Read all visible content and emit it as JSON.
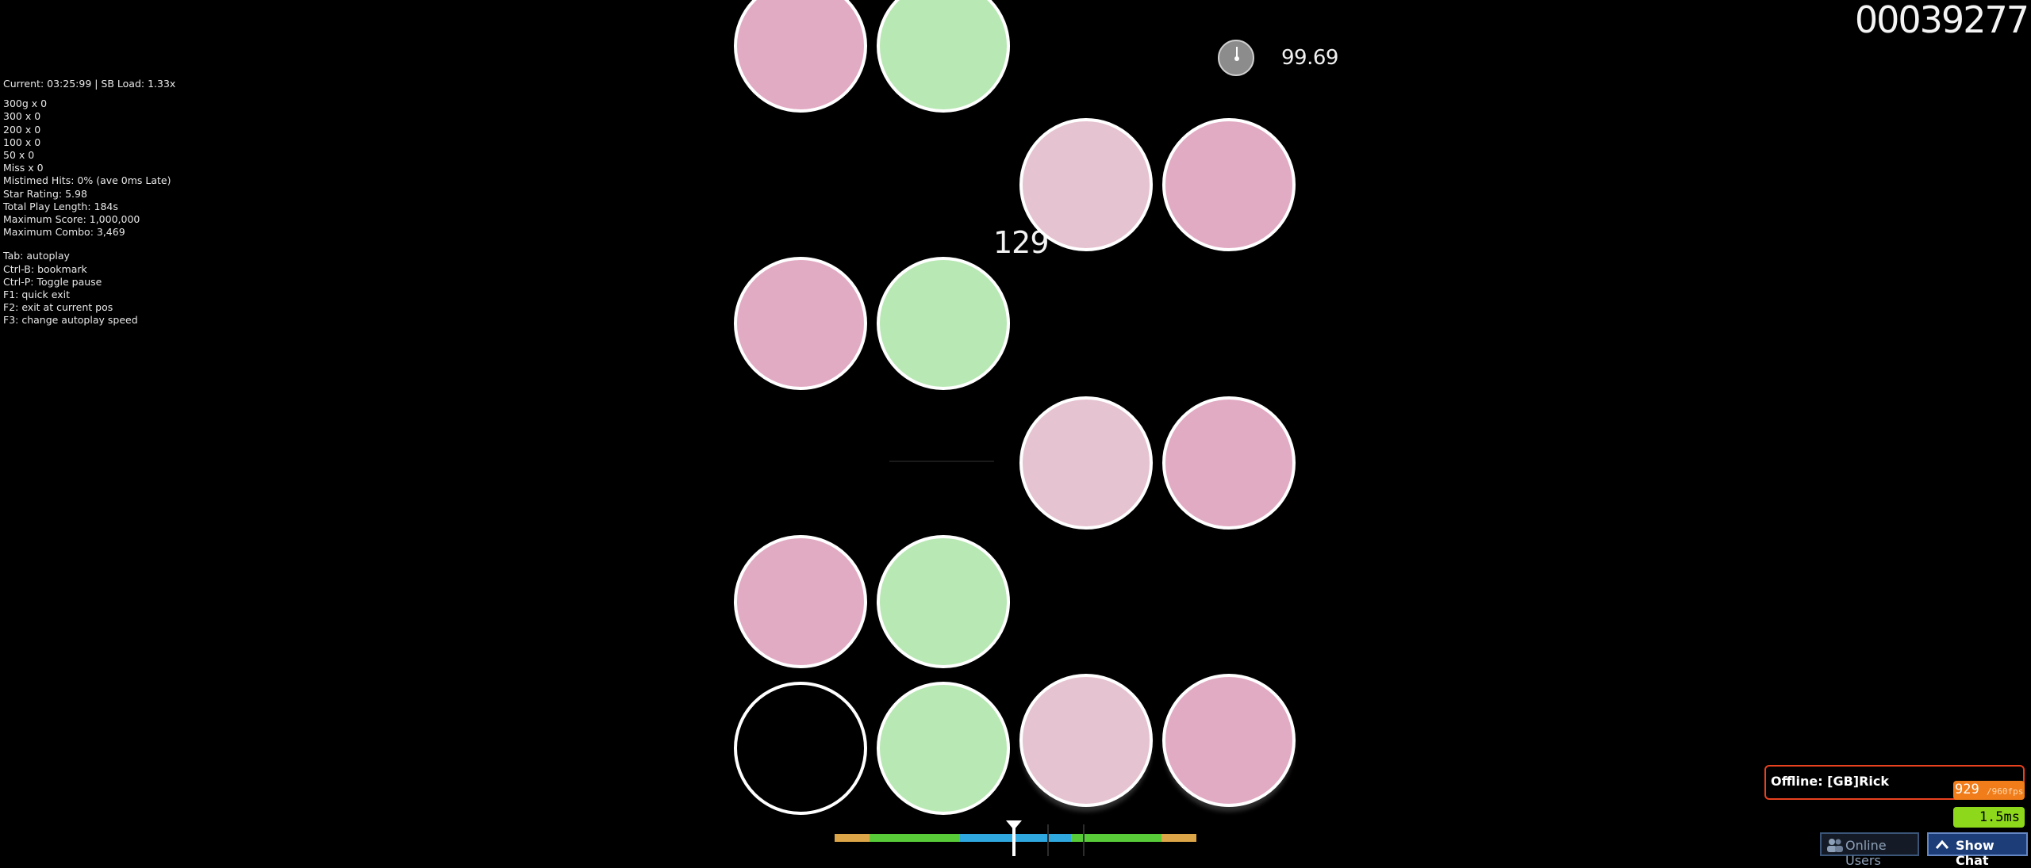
{
  "debug": {
    "current_line": "Current: 03:25:99 | SB Load: 1.33x",
    "judgements": [
      "300g x 0",
      "300 x 0",
      "200 x 0",
      "100 x 0",
      "50 x 0",
      "Miss x 0"
    ],
    "stats": [
      "Mistimed Hits: 0% (ave 0ms Late)",
      "Star Rating: 5.98",
      "Total Play Length: 184s",
      "Maximum Score: 1,000,000",
      "Maximum Combo: 3,469"
    ],
    "shortcuts": [
      "Tab: autoplay",
      "Ctrl-B: bookmark",
      "Ctrl-P: Toggle pause",
      "F1: quick exit",
      "F2: exit at current pos",
      "F3: change autoplay speed"
    ]
  },
  "hud": {
    "score": "00039277",
    "accuracy": "99.69",
    "combo": "129"
  },
  "status": {
    "user": "Offline: [GB]Rick",
    "fps": "929",
    "fps_max": "/960fps",
    "latency": "1.5ms"
  },
  "buttons": {
    "online_users": "Online Users",
    "show_chat": "Show Chat"
  },
  "colors": {
    "note_pink": "#e2abc4",
    "note_light_pink": "#e6c3d0",
    "note_green": "#b8e8b4",
    "user_panel_border": "#e8421f",
    "fps_bg": "#f07d1a",
    "latency_bg": "#8ed81c"
  }
}
